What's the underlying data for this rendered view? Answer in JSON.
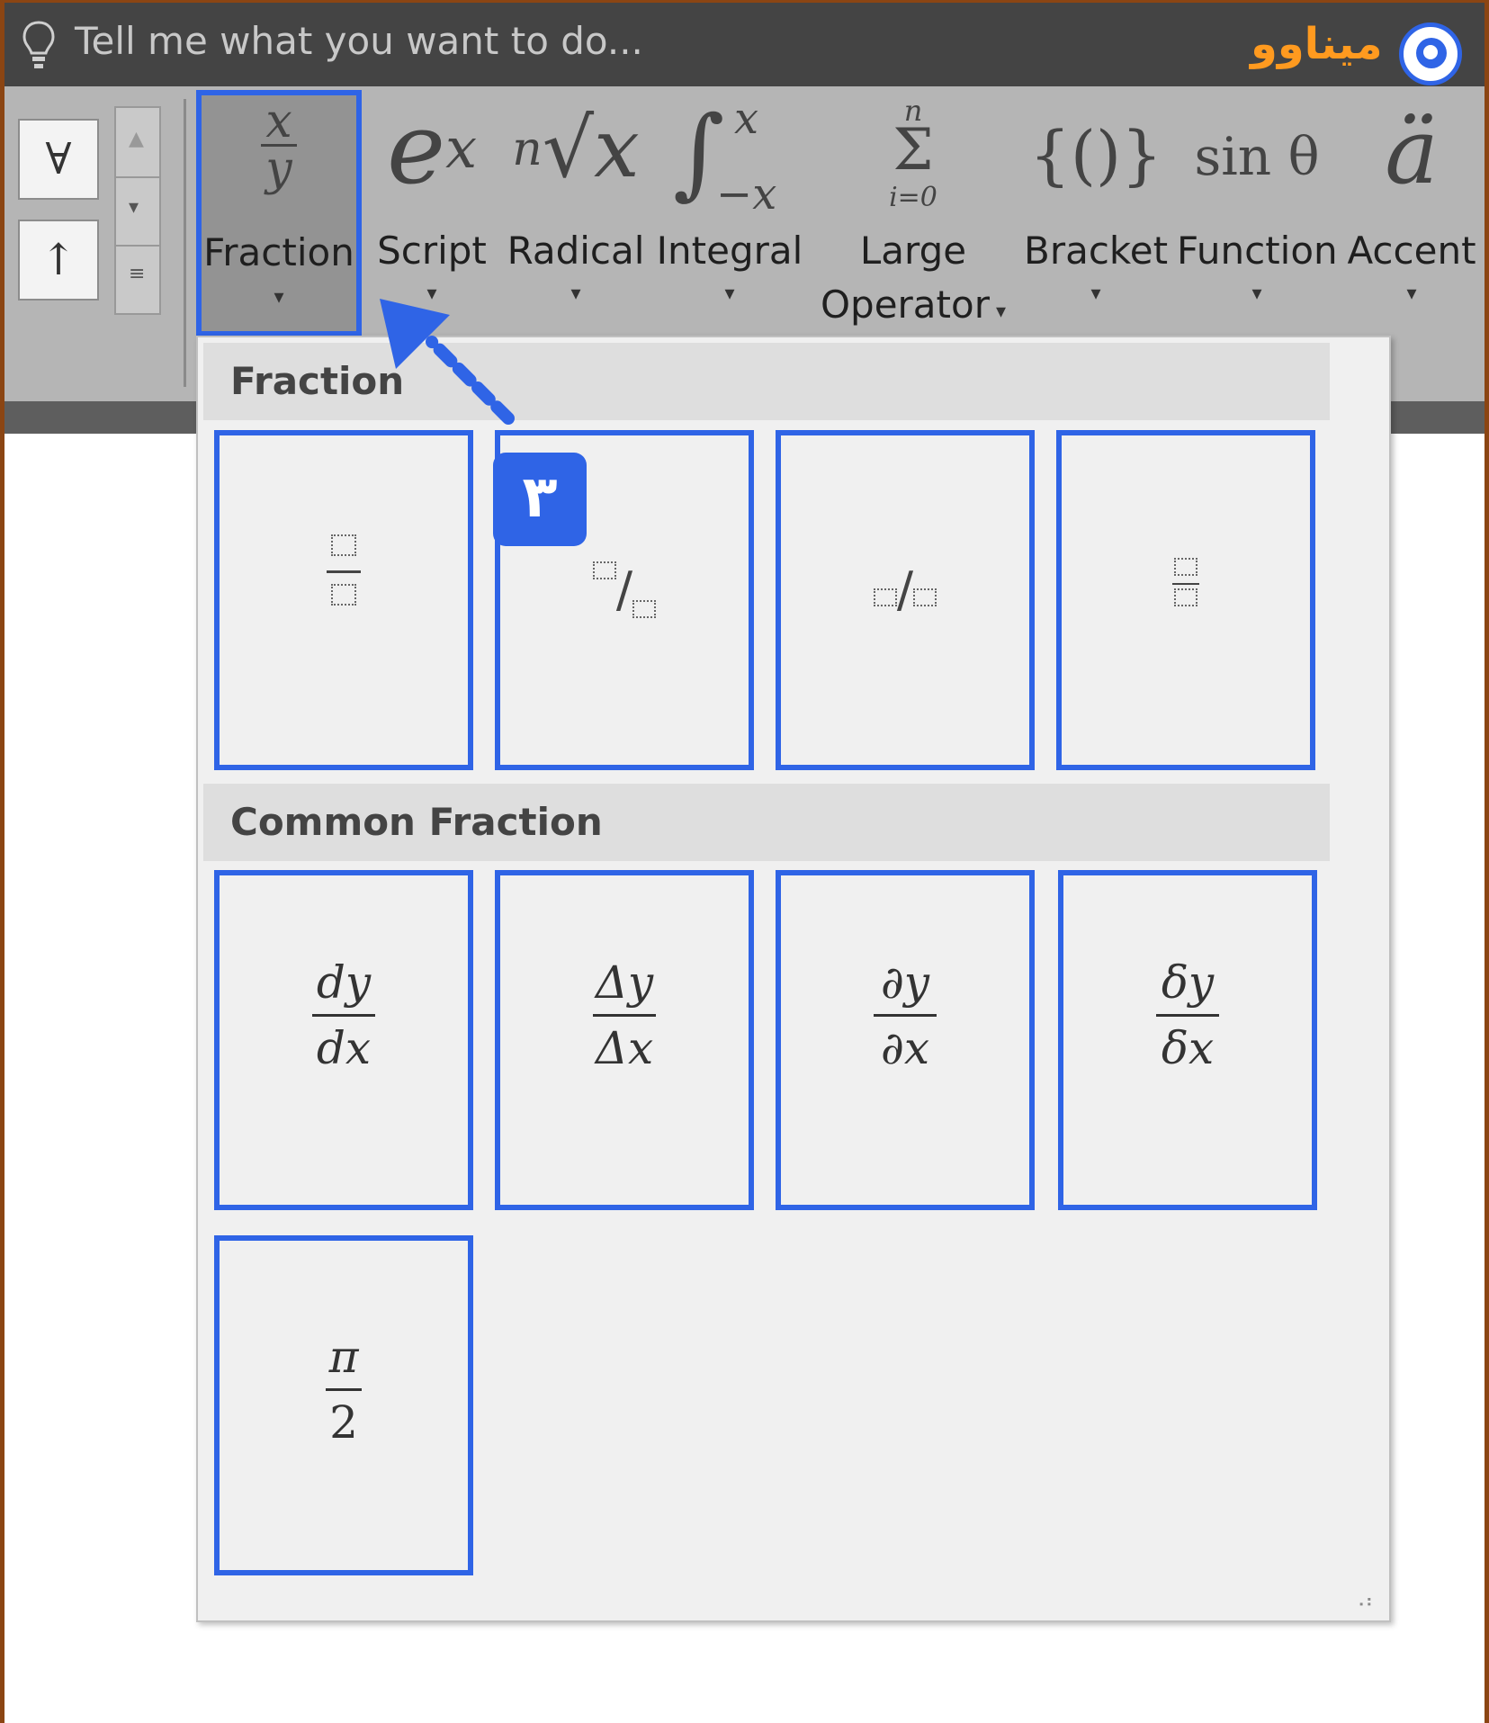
{
  "tellbar": {
    "placeholder": "Tell me what you want to do...",
    "brand_text": "میناوو"
  },
  "symbols": {
    "for_all": "∀",
    "up_arrow": "↑"
  },
  "ribbon": {
    "buttons": [
      {
        "label": "Fraction",
        "glyph_num": "x",
        "glyph_den": "y"
      },
      {
        "label": "Script",
        "glyph": "e",
        "glyph_sup": "x"
      },
      {
        "label": "Radical",
        "glyph_idx": "n",
        "glyph": "√x"
      },
      {
        "label": "Integral",
        "glyph": "∫",
        "glyph_sup": "x",
        "glyph_sub": "−x"
      },
      {
        "label_line1": "Large",
        "label_line2": "Operator",
        "glyph_top": "n",
        "glyph": "Σ",
        "glyph_bot": "i=0"
      },
      {
        "label": "Bracket",
        "glyph": "{()}"
      },
      {
        "label": "Function",
        "glyph": "sin θ"
      },
      {
        "label": "Accent",
        "glyph": "ä"
      }
    ]
  },
  "panel": {
    "section1_title": "Fraction",
    "section2_title": "Common Fraction",
    "common": [
      {
        "num": "dy",
        "den": "dx"
      },
      {
        "num": "Δy",
        "den": "Δx"
      },
      {
        "num": "∂y",
        "den": "∂x"
      },
      {
        "num": "δy",
        "den": "δx"
      },
      {
        "num": "π",
        "den": "2"
      }
    ]
  },
  "annotation": {
    "step": "۳",
    "color": "#2f64e6"
  }
}
